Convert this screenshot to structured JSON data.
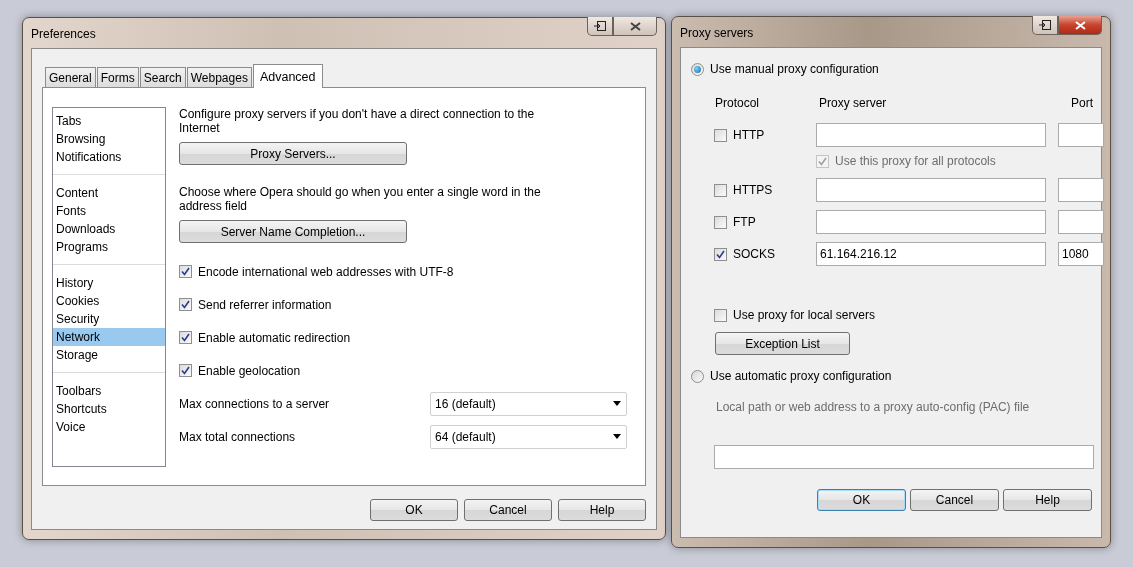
{
  "preferences": {
    "title": "Preferences",
    "active": false,
    "tabs": [
      {
        "label": "General",
        "selected": false
      },
      {
        "label": "Forms",
        "selected": false
      },
      {
        "label": "Search",
        "selected": false
      },
      {
        "label": "Webpages",
        "selected": false
      },
      {
        "label": "Advanced",
        "selected": true
      }
    ],
    "sidebar": {
      "groups": [
        [
          {
            "label": "Tabs",
            "selected": false
          },
          {
            "label": "Browsing",
            "selected": false
          },
          {
            "label": "Notifications",
            "selected": false
          }
        ],
        [
          {
            "label": "Content",
            "selected": false
          },
          {
            "label": "Fonts",
            "selected": false
          },
          {
            "label": "Downloads",
            "selected": false
          },
          {
            "label": "Programs",
            "selected": false
          }
        ],
        [
          {
            "label": "History",
            "selected": false
          },
          {
            "label": "Cookies",
            "selected": false
          },
          {
            "label": "Security",
            "selected": false
          },
          {
            "label": "Network",
            "selected": true
          },
          {
            "label": "Storage",
            "selected": false
          }
        ],
        [
          {
            "label": "Toolbars",
            "selected": false
          },
          {
            "label": "Shortcuts",
            "selected": false
          },
          {
            "label": "Voice",
            "selected": false
          }
        ]
      ]
    },
    "content": [
      {
        "kind": "text",
        "text": "Configure proxy servers if you don't have a direct connection to the Internet"
      },
      {
        "kind": "button",
        "label": "Proxy Servers..."
      },
      {
        "kind": "text",
        "text": "Choose where Opera should go when you enter a single word in the address field"
      },
      {
        "kind": "button",
        "label": "Server Name Completion..."
      },
      {
        "kind": "checkbox",
        "label": "Encode international web addresses with UTF-8",
        "checked": true
      },
      {
        "kind": "checkbox",
        "label": "Send referrer information",
        "checked": true
      },
      {
        "kind": "checkbox",
        "label": "Enable automatic redirection",
        "checked": true
      },
      {
        "kind": "checkbox",
        "label": "Enable geolocation",
        "checked": true
      },
      {
        "kind": "select",
        "label": "Max connections to a server",
        "value": "16 (default)"
      },
      {
        "kind": "select",
        "label": "Max total connections",
        "value": "64 (default)"
      }
    ],
    "buttons": [
      {
        "label": "OK",
        "default": false
      },
      {
        "label": "Cancel",
        "default": false
      },
      {
        "label": "Help",
        "default": false
      }
    ]
  },
  "proxy": {
    "title": "Proxy servers",
    "active": true,
    "manual": {
      "label": "Use manual proxy configuration",
      "selected": true
    },
    "columns": [
      "Protocol",
      "Proxy server",
      "Port"
    ],
    "protocols": [
      {
        "label": "HTTP",
        "checked": false
      },
      {
        "label": "HTTPS",
        "checked": false
      },
      {
        "label": "FTP",
        "checked": false
      },
      {
        "label": "SOCKS",
        "checked": true,
        "server": "61.164.216.12",
        "port": "1080"
      }
    ],
    "use_for_all": {
      "label": "Use this proxy for all protocols",
      "checked": true,
      "disabled": true
    },
    "local": {
      "label": "Use proxy for local servers",
      "checked": false
    },
    "exception_button": "Exception List",
    "automatic": {
      "label": "Use automatic proxy configuration",
      "selected": false
    },
    "pac_hint": "Local path or web address to a proxy auto-config (PAC) file",
    "buttons": [
      {
        "label": "OK",
        "default": true
      },
      {
        "label": "Cancel",
        "default": false
      },
      {
        "label": "Help",
        "default": false
      }
    ]
  }
}
